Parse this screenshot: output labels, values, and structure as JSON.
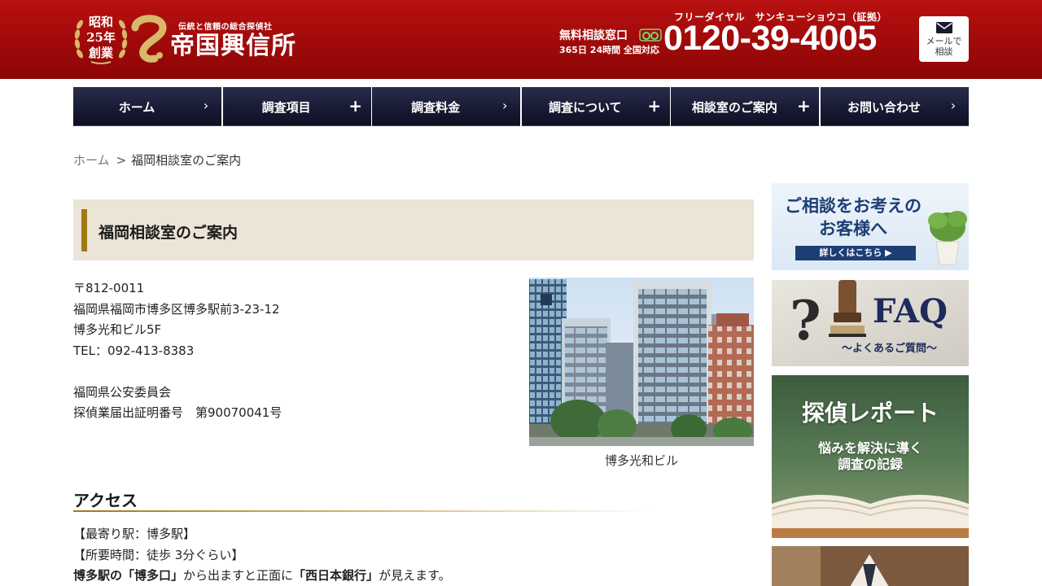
{
  "header": {
    "emblem": {
      "line1": "昭和",
      "line2": "25年",
      "line3": "創業"
    },
    "tagline": "伝統と信頼の総合探偵社",
    "company_name": "帝国興信所",
    "freedial_reading": "フリーダイヤル　サンキューショウコ（証拠）",
    "consult_label": "無料相談窓口",
    "hours": "365日 24時間 全国対応",
    "phone": "0120-39-4005",
    "mail_button_line1": "メールで",
    "mail_button_line2": "相談",
    "icons": {
      "freedial": "freedial-icon",
      "mail": "mail-icon"
    }
  },
  "nav": {
    "items": [
      {
        "label": "ホーム",
        "mark": "›"
      },
      {
        "label": "調査項目",
        "mark": "+"
      },
      {
        "label": "調査料金",
        "mark": "›"
      },
      {
        "label": "調査について",
        "mark": "+"
      },
      {
        "label": "相談室のご案内",
        "mark": "+"
      },
      {
        "label": "お問い合わせ",
        "mark": "›"
      }
    ]
  },
  "breadcrumb": {
    "home": "ホーム",
    "separator": ">",
    "current": "福岡相談室のご案内"
  },
  "main": {
    "title": "福岡相談室のご案内",
    "address": {
      "postal": "〒812-0011",
      "line1": "福岡県福岡市博多区博多駅前3-23-12",
      "line2": "博多光和ビル5F",
      "tel": "TEL：092-413-8383",
      "license_authority": "福岡県公安委員会",
      "license_number": "探偵業届出証明番号　第90070041号"
    },
    "photo_caption": "博多光和ビル",
    "access": {
      "heading": "アクセス",
      "station": "【最寄り駅：博多駅】",
      "time": "【所要時間：徒歩 3分ぐらい】",
      "direction_part1": "博多駅の",
      "direction_part2": "「博多口」",
      "direction_part3": "から出ますと正面に",
      "direction_part4": "「西日本銀行」",
      "direction_part5": "が見えます。"
    }
  },
  "sidebar": {
    "banner1": {
      "title_line1": "ご相談をお考えの",
      "title_line2": "お客様へ",
      "button": "詳しくはこちら ▶"
    },
    "banner2": {
      "mark": "?",
      "title": "FAQ",
      "subtitle": "～よくあるご質問～"
    },
    "banner3": {
      "title": "探偵レポート",
      "sub1": "悩みを解決に導く",
      "sub2": "調査の記録"
    }
  },
  "colors": {
    "header_red": "#a00a0a",
    "nav_navy": "#191b34",
    "title_bg": "#ece4d6",
    "gold_accent": "#a27a12"
  }
}
